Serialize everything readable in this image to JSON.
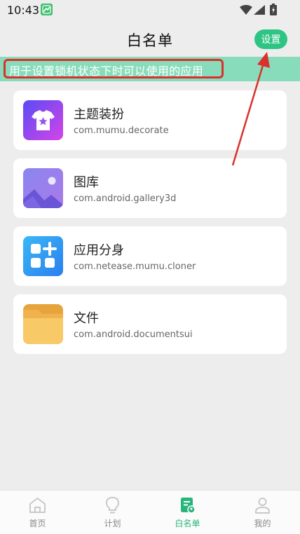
{
  "status_bar": {
    "time": "10:43"
  },
  "header": {
    "title": "白名单",
    "settings_label": "设置"
  },
  "notice": {
    "text": "用于设置锁机状态下时可以使用的应用"
  },
  "apps": [
    {
      "name": "主题装扮",
      "package": "com.mumu.decorate",
      "icon": "tshirt-icon"
    },
    {
      "name": "图库",
      "package": "com.android.gallery3d",
      "icon": "gallery-icon"
    },
    {
      "name": "应用分身",
      "package": "com.netease.mumu.cloner",
      "icon": "app-cloner-icon"
    },
    {
      "name": "文件",
      "package": "com.android.documentsui",
      "icon": "folder-icon"
    }
  ],
  "bottom_nav": {
    "items": [
      {
        "label": "首页",
        "icon": "home-icon",
        "active": false
      },
      {
        "label": "计划",
        "icon": "lightbulb-icon",
        "active": false
      },
      {
        "label": "白名单",
        "icon": "whitelist-icon",
        "active": true
      },
      {
        "label": "我的",
        "icon": "profile-icon",
        "active": false
      }
    ]
  },
  "colors": {
    "accent": "#2ec584",
    "banner": "#89dcbb",
    "highlight": "#d9312c",
    "nav_active": "#27b57a"
  }
}
